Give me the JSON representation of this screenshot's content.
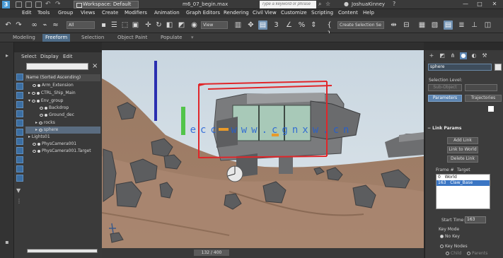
{
  "titlebar": {
    "logo": "3",
    "workspace": "Workspace: Default",
    "file_title": "m6_07_begin.max",
    "search_placeholder": "Type a keyword or phrase",
    "user": "JoshuaKinney",
    "min": "—",
    "max": "□",
    "close": "✕"
  },
  "menubar": [
    "Edit",
    "Tools",
    "Group",
    "Views",
    "Create",
    "Modifiers",
    "Animation",
    "Graph Editors",
    "Rendering",
    "Civil View",
    "Customize",
    "Scripting",
    "Content",
    "Help"
  ],
  "toolbar": {
    "filter_value": "All",
    "view_value": "View",
    "selection_set_value": "Create Selection Se"
  },
  "ribbon_tabs": [
    "Modeling",
    "Freeform",
    "Selection",
    "Object Paint",
    "Populate"
  ],
  "ribbon_active": "Freeform",
  "explorer": {
    "menus": [
      "Select",
      "Display",
      "Edit"
    ],
    "sort_header": "Name (Sorted Ascending)",
    "items": [
      {
        "label": "Arm_Extension"
      },
      {
        "label": "CTRL_Ship_Main"
      },
      {
        "label": "Env_group"
      },
      {
        "label": "Backdrop"
      },
      {
        "label": "Ground_dec"
      },
      {
        "label": "rocks"
      },
      {
        "label": "sphere"
      },
      {
        "label": "Lights01"
      },
      {
        "label": "PhysCamera001"
      },
      {
        "label": "PhysCamera001.Target"
      }
    ]
  },
  "timeline": {
    "frame_readout": "132 / 400"
  },
  "command_panel": {
    "object_name": "sphere",
    "selection_level_label": "Selection Level:",
    "sub_object_label": "Sub-Object",
    "tab_parameters": "Parameters",
    "tab_trajectories": "Trajectories",
    "link_params_title": "Link Params",
    "add_link": "Add Link",
    "link_to_world": "Link to World",
    "delete_link": "Delete Link",
    "parent_col": "Frame #",
    "target_col": "Target",
    "link_rows": [
      {
        "frame": "0",
        "target": "World"
      },
      {
        "frame": "163",
        "target": "Claw_Base"
      }
    ],
    "start_time_label": "Start Time:",
    "start_time_value": "163",
    "key_mode_label": "Key Mode",
    "no_key_label": "No Key",
    "key_nodes_label": "Key Nodes",
    "child_label": "Child",
    "parents_label": "Parents"
  },
  "watermark": "ecc www.cgnxw.cn",
  "colors": {
    "accent": "#5c84b0",
    "selection_box": "#e0262a",
    "gizmo_pole": "#2a2fb0"
  }
}
